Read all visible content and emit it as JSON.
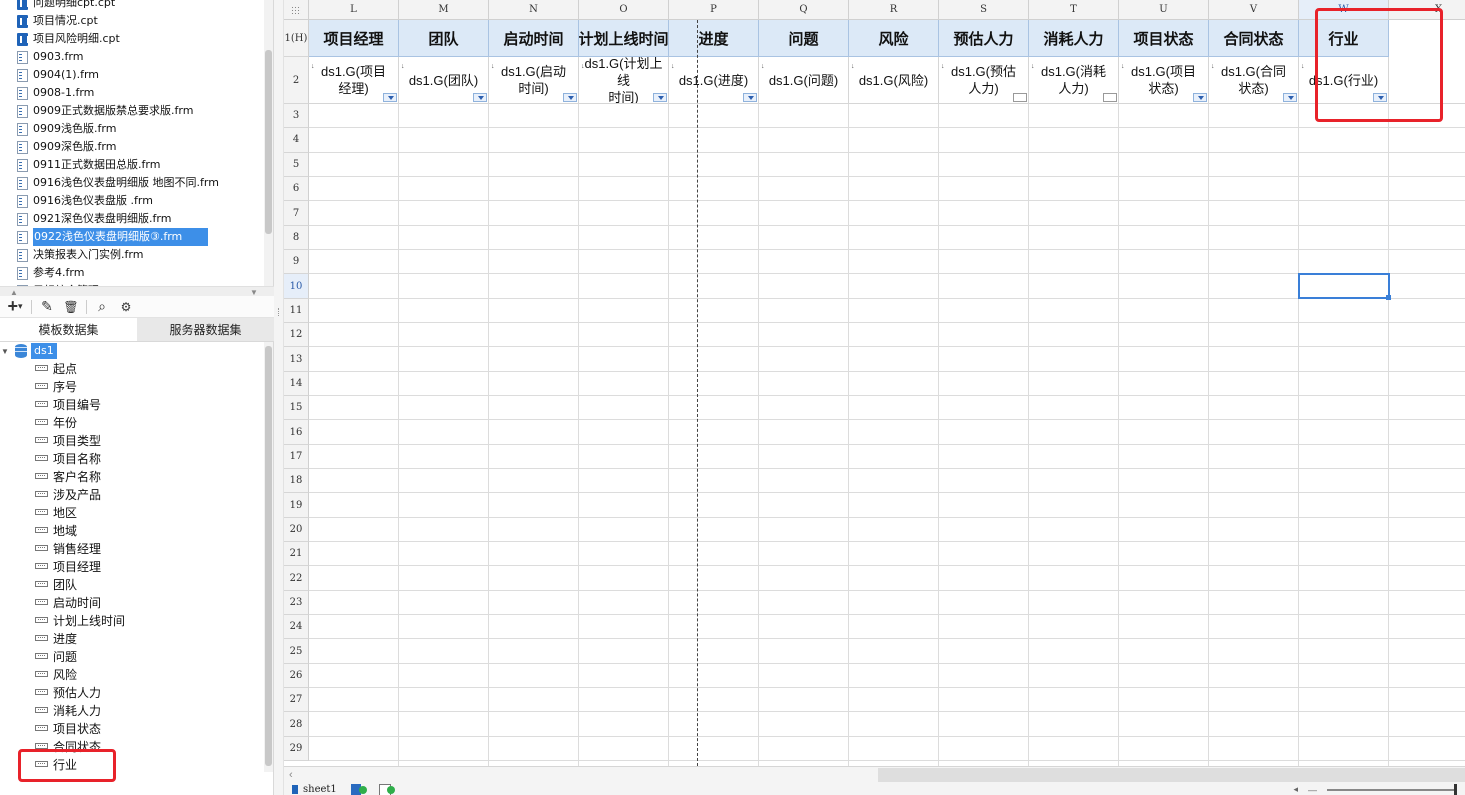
{
  "files": [
    {
      "name": "问题明细cpt.cpt",
      "type": "cpt",
      "selected": false
    },
    {
      "name": "项目情况.cpt",
      "type": "cpt",
      "selected": false
    },
    {
      "name": "项目风险明细.cpt",
      "type": "cpt",
      "selected": false
    },
    {
      "name": "0903.frm",
      "type": "frm",
      "selected": false
    },
    {
      "name": "0904(1).frm",
      "type": "frm",
      "selected": false
    },
    {
      "name": "0908-1.frm",
      "type": "frm",
      "selected": false
    },
    {
      "name": "0909正式数据版禁总要求版.frm",
      "type": "frm",
      "selected": false
    },
    {
      "name": "0909浅色版.frm",
      "type": "frm",
      "selected": false
    },
    {
      "name": "0909深色版.frm",
      "type": "frm",
      "selected": false
    },
    {
      "name": "0911正式数据田总版.frm",
      "type": "frm",
      "selected": false
    },
    {
      "name": "0916浅色仪表盘明细版 地图不同.frm",
      "type": "frm",
      "selected": false
    },
    {
      "name": "0916浅色仪表盘版 .frm",
      "type": "frm",
      "selected": false
    },
    {
      "name": "0921深色仪表盘明细版.frm",
      "type": "frm",
      "selected": false
    },
    {
      "name": "0922浅色仪表盘明细版③.frm",
      "type": "frm",
      "selected": true
    },
    {
      "name": "决策报表入门实例.frm",
      "type": "frm",
      "selected": false
    },
    {
      "name": "参考4.frm",
      "type": "frm",
      "selected": false
    },
    {
      "name": "目标综合管理.frm",
      "type": "frm",
      "selected": false
    }
  ],
  "toolbar": {
    "add_label": "+",
    "add_caret": "▾",
    "edit_icon": "✎",
    "delete_icon": "🗑",
    "preview_icon": "⌕",
    "settings_icon": "⚙"
  },
  "ds_tabs": {
    "template": "模板数据集",
    "server": "服务器数据集"
  },
  "dataset": {
    "name": "ds1",
    "fields": [
      "起点",
      "序号",
      "项目编号",
      "年份",
      "项目类型",
      "项目名称",
      "客户名称",
      "涉及产品",
      "地区",
      "地域",
      "销售经理",
      "项目经理",
      "团队",
      "启动时间",
      "计划上线时间",
      "进度",
      "问题",
      "风险",
      "预估人力",
      "消耗人力",
      "项目状态",
      "合同状态",
      "行业"
    ]
  },
  "grid": {
    "columns": [
      {
        "letter": "L",
        "header": "项目经理",
        "cell": "ds1.G(项目\n经理)",
        "dd": "blue"
      },
      {
        "letter": "M",
        "header": "团队",
        "cell": "ds1.G(团队)",
        "dd": "blue"
      },
      {
        "letter": "N",
        "header": "启动时间",
        "cell": "ds1.G(启动\n时间)",
        "dd": "blue"
      },
      {
        "letter": "O",
        "header": "计划上线时间",
        "cell": "ds1.G(计划上线\n时间)",
        "dd": "blue"
      },
      {
        "letter": "P",
        "header": "进度",
        "cell": "ds1.G(进度)",
        "dd": "blue"
      },
      {
        "letter": "Q",
        "header": "问题",
        "cell": "ds1.G(问题)",
        "dd": "none"
      },
      {
        "letter": "R",
        "header": "风险",
        "cell": "ds1.G(风险)",
        "dd": "none"
      },
      {
        "letter": "S",
        "header": "预估人力",
        "cell": "ds1.G(预估\n人力)",
        "dd": "plain"
      },
      {
        "letter": "T",
        "header": "消耗人力",
        "cell": "ds1.G(消耗\n人力)",
        "dd": "plain"
      },
      {
        "letter": "U",
        "header": "项目状态",
        "cell": "ds1.G(项目\n状态)",
        "dd": "blue"
      },
      {
        "letter": "V",
        "header": "合同状态",
        "cell": "ds1.G(合同\n状态)",
        "dd": "blue"
      },
      {
        "letter": "W",
        "header": "行业",
        "cell": "ds1.G(行业)",
        "dd": "blue"
      },
      {
        "letter": "X",
        "header": "",
        "cell": "",
        "dd": "none"
      }
    ],
    "row_labels": [
      "1(H)",
      "2",
      "3",
      "4",
      "5",
      "6",
      "7",
      "8",
      "9",
      "10",
      "11",
      "12",
      "13",
      "14",
      "15",
      "16",
      "17",
      "18",
      "19",
      "20",
      "21",
      "22",
      "23",
      "24",
      "25",
      "26",
      "27",
      "28",
      "29"
    ],
    "selected_row": "10",
    "selected_col": "W"
  },
  "bottom": {
    "sheet_name": "sheet1",
    "scroll_left_arrow": "‹"
  },
  "colors": {
    "header_fill": "#dce9f7",
    "selection": "#3a7fd8",
    "highlight_box": "#e8222a",
    "selected_item": "#3d8fe8"
  }
}
